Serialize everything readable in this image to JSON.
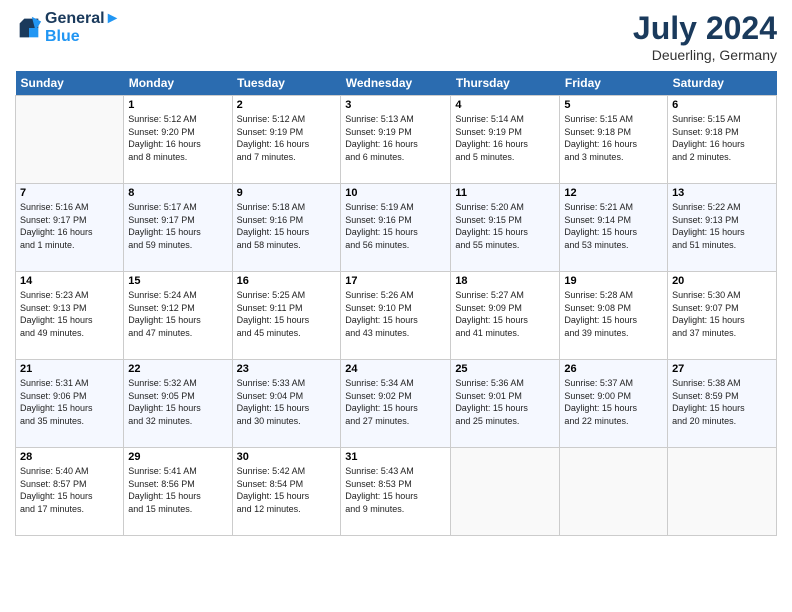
{
  "header": {
    "logo_line1": "General",
    "logo_line2": "Blue",
    "month_year": "July 2024",
    "location": "Deuerling, Germany"
  },
  "weekdays": [
    "Sunday",
    "Monday",
    "Tuesday",
    "Wednesday",
    "Thursday",
    "Friday",
    "Saturday"
  ],
  "weeks": [
    [
      {
        "day": "",
        "info": ""
      },
      {
        "day": "1",
        "info": "Sunrise: 5:12 AM\nSunset: 9:20 PM\nDaylight: 16 hours\nand 8 minutes."
      },
      {
        "day": "2",
        "info": "Sunrise: 5:12 AM\nSunset: 9:19 PM\nDaylight: 16 hours\nand 7 minutes."
      },
      {
        "day": "3",
        "info": "Sunrise: 5:13 AM\nSunset: 9:19 PM\nDaylight: 16 hours\nand 6 minutes."
      },
      {
        "day": "4",
        "info": "Sunrise: 5:14 AM\nSunset: 9:19 PM\nDaylight: 16 hours\nand 5 minutes."
      },
      {
        "day": "5",
        "info": "Sunrise: 5:15 AM\nSunset: 9:18 PM\nDaylight: 16 hours\nand 3 minutes."
      },
      {
        "day": "6",
        "info": "Sunrise: 5:15 AM\nSunset: 9:18 PM\nDaylight: 16 hours\nand 2 minutes."
      }
    ],
    [
      {
        "day": "7",
        "info": "Sunrise: 5:16 AM\nSunset: 9:17 PM\nDaylight: 16 hours\nand 1 minute."
      },
      {
        "day": "8",
        "info": "Sunrise: 5:17 AM\nSunset: 9:17 PM\nDaylight: 15 hours\nand 59 minutes."
      },
      {
        "day": "9",
        "info": "Sunrise: 5:18 AM\nSunset: 9:16 PM\nDaylight: 15 hours\nand 58 minutes."
      },
      {
        "day": "10",
        "info": "Sunrise: 5:19 AM\nSunset: 9:16 PM\nDaylight: 15 hours\nand 56 minutes."
      },
      {
        "day": "11",
        "info": "Sunrise: 5:20 AM\nSunset: 9:15 PM\nDaylight: 15 hours\nand 55 minutes."
      },
      {
        "day": "12",
        "info": "Sunrise: 5:21 AM\nSunset: 9:14 PM\nDaylight: 15 hours\nand 53 minutes."
      },
      {
        "day": "13",
        "info": "Sunrise: 5:22 AM\nSunset: 9:13 PM\nDaylight: 15 hours\nand 51 minutes."
      }
    ],
    [
      {
        "day": "14",
        "info": "Sunrise: 5:23 AM\nSunset: 9:13 PM\nDaylight: 15 hours\nand 49 minutes."
      },
      {
        "day": "15",
        "info": "Sunrise: 5:24 AM\nSunset: 9:12 PM\nDaylight: 15 hours\nand 47 minutes."
      },
      {
        "day": "16",
        "info": "Sunrise: 5:25 AM\nSunset: 9:11 PM\nDaylight: 15 hours\nand 45 minutes."
      },
      {
        "day": "17",
        "info": "Sunrise: 5:26 AM\nSunset: 9:10 PM\nDaylight: 15 hours\nand 43 minutes."
      },
      {
        "day": "18",
        "info": "Sunrise: 5:27 AM\nSunset: 9:09 PM\nDaylight: 15 hours\nand 41 minutes."
      },
      {
        "day": "19",
        "info": "Sunrise: 5:28 AM\nSunset: 9:08 PM\nDaylight: 15 hours\nand 39 minutes."
      },
      {
        "day": "20",
        "info": "Sunrise: 5:30 AM\nSunset: 9:07 PM\nDaylight: 15 hours\nand 37 minutes."
      }
    ],
    [
      {
        "day": "21",
        "info": "Sunrise: 5:31 AM\nSunset: 9:06 PM\nDaylight: 15 hours\nand 35 minutes."
      },
      {
        "day": "22",
        "info": "Sunrise: 5:32 AM\nSunset: 9:05 PM\nDaylight: 15 hours\nand 32 minutes."
      },
      {
        "day": "23",
        "info": "Sunrise: 5:33 AM\nSunset: 9:04 PM\nDaylight: 15 hours\nand 30 minutes."
      },
      {
        "day": "24",
        "info": "Sunrise: 5:34 AM\nSunset: 9:02 PM\nDaylight: 15 hours\nand 27 minutes."
      },
      {
        "day": "25",
        "info": "Sunrise: 5:36 AM\nSunset: 9:01 PM\nDaylight: 15 hours\nand 25 minutes."
      },
      {
        "day": "26",
        "info": "Sunrise: 5:37 AM\nSunset: 9:00 PM\nDaylight: 15 hours\nand 22 minutes."
      },
      {
        "day": "27",
        "info": "Sunrise: 5:38 AM\nSunset: 8:59 PM\nDaylight: 15 hours\nand 20 minutes."
      }
    ],
    [
      {
        "day": "28",
        "info": "Sunrise: 5:40 AM\nSunset: 8:57 PM\nDaylight: 15 hours\nand 17 minutes."
      },
      {
        "day": "29",
        "info": "Sunrise: 5:41 AM\nSunset: 8:56 PM\nDaylight: 15 hours\nand 15 minutes."
      },
      {
        "day": "30",
        "info": "Sunrise: 5:42 AM\nSunset: 8:54 PM\nDaylight: 15 hours\nand 12 minutes."
      },
      {
        "day": "31",
        "info": "Sunrise: 5:43 AM\nSunset: 8:53 PM\nDaylight: 15 hours\nand 9 minutes."
      },
      {
        "day": "",
        "info": ""
      },
      {
        "day": "",
        "info": ""
      },
      {
        "day": "",
        "info": ""
      }
    ]
  ]
}
